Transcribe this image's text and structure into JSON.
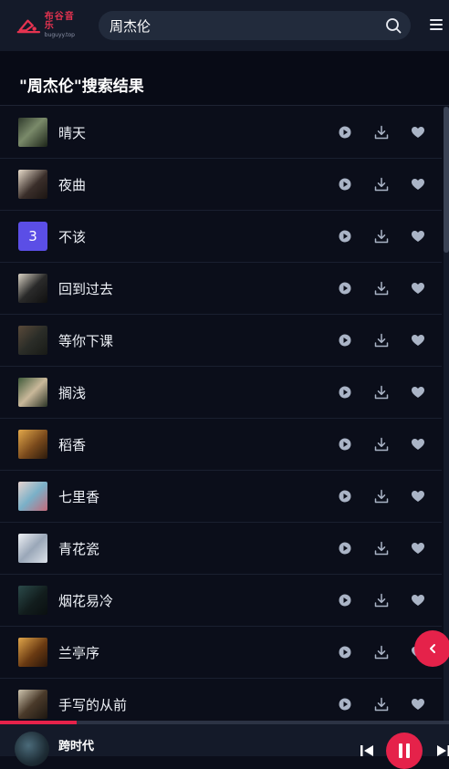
{
  "header": {
    "logo_title": "布谷音乐",
    "logo_subtitle": "buguyy.top",
    "search_value": "周杰伦",
    "accent": "#e53350"
  },
  "page_title": "\"周杰伦\"搜索结果",
  "songs": [
    {
      "name": "晴天",
      "cover": "photo"
    },
    {
      "name": "夜曲",
      "cover": "photo"
    },
    {
      "name": "不该",
      "cover": "number",
      "badge": "3"
    },
    {
      "name": "回到过去",
      "cover": "photo"
    },
    {
      "name": "等你下课",
      "cover": "photo"
    },
    {
      "name": "搁浅",
      "cover": "photo"
    },
    {
      "name": "稻香",
      "cover": "photo"
    },
    {
      "name": "七里香",
      "cover": "photo"
    },
    {
      "name": "青花瓷",
      "cover": "photo"
    },
    {
      "name": "烟花易冷",
      "cover": "photo"
    },
    {
      "name": "兰亭序",
      "cover": "photo"
    },
    {
      "name": "手写的从前",
      "cover": "photo"
    }
  ],
  "row_actions": [
    "play-icon",
    "download-icon",
    "heart-icon"
  ],
  "player": {
    "song": "跨时代",
    "progress": 0.17,
    "state": "playing"
  }
}
